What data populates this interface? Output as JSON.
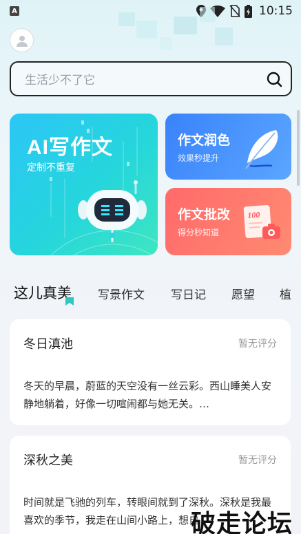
{
  "status_bar": {
    "time": "10:15",
    "app_icon_letter": "A"
  },
  "search": {
    "placeholder": "生活少不了它"
  },
  "feature_cards": {
    "ai_write": {
      "title": "AI写作文",
      "subtitle": "定制不重复"
    },
    "polish": {
      "title": "作文润色",
      "subtitle": "效果秒提升"
    },
    "review": {
      "title": "作文批改",
      "subtitle": "得分秒知道",
      "badge": "100"
    }
  },
  "tabs": [
    "这儿真美",
    "写景作文",
    "写日记",
    "愿望",
    "植"
  ],
  "articles": [
    {
      "title": "冬日滇池",
      "rating": "暂无评分",
      "excerpt": "冬天的早晨，蔚蓝的天空没有一丝云彩。西山睡美人安静地躺着，好像一切喧闹都与她无关。…"
    },
    {
      "title": "深秋之美",
      "rating": "暂无评分",
      "excerpt": "时间就是飞驰的列车，转眼间就到了深秋。深秋是我最喜欢的季节，我走在山间小路上，想自"
    }
  ],
  "watermark": "破走论坛",
  "colors": {
    "ai_card": "#2cc6f6",
    "polish_card": "#3a82fb",
    "review_card": "#ff6a6a",
    "tab_marker": "#2fc7c0"
  },
  "icons": [
    "signal-location-icon",
    "wifi-icon",
    "no-sim-icon",
    "battery-icon",
    "search-icon",
    "avatar-icon",
    "robot-icon",
    "feather-icon",
    "score-paper-icon",
    "camera-icon"
  ]
}
